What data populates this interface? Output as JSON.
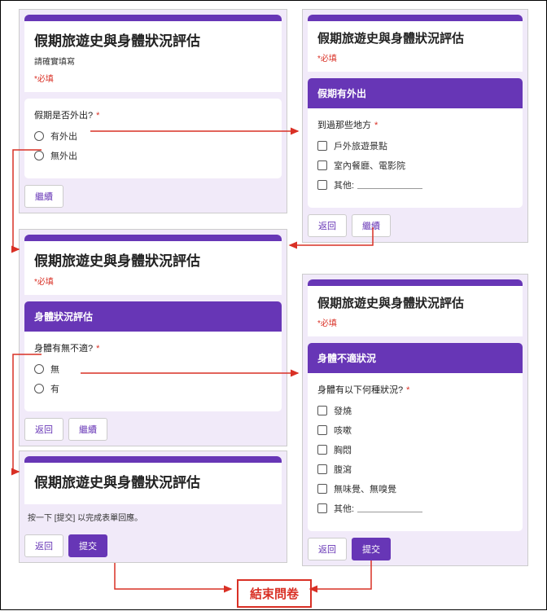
{
  "formTitle": "假期旅遊史與身體狀況評估",
  "required": "*必填",
  "card1": {
    "subtitle": "請確實填寫",
    "q": "假期是否外出?",
    "opt1": "有外出",
    "opt2": "無外出",
    "continue": "繼續"
  },
  "card2": {
    "section": "假期有外出",
    "q": "到過那些地方",
    "opt1": "戶外旅遊景點",
    "opt2": "室內餐廳、電影院",
    "opt3": "其他:",
    "back": "返回",
    "continue": "繼續"
  },
  "card3": {
    "section": "身體狀況評估",
    "q": "身體有無不適?",
    "opt1": "無",
    "opt2": "有",
    "back": "返回",
    "continue": "繼續"
  },
  "card4": {
    "section": "身體不適狀況",
    "q": "身體有以下何種狀況?",
    "opt1": "發燒",
    "opt2": "咳嗽",
    "opt3": "胸悶",
    "opt4": "腹瀉",
    "opt5": "無味覺、無嗅覺",
    "opt6": "其他:",
    "back": "返回",
    "submit": "提交"
  },
  "card5": {
    "subtitle": "按一下 [提交] 以完成表單回應。",
    "back": "返回",
    "submit": "提交"
  },
  "end": "結束問卷"
}
